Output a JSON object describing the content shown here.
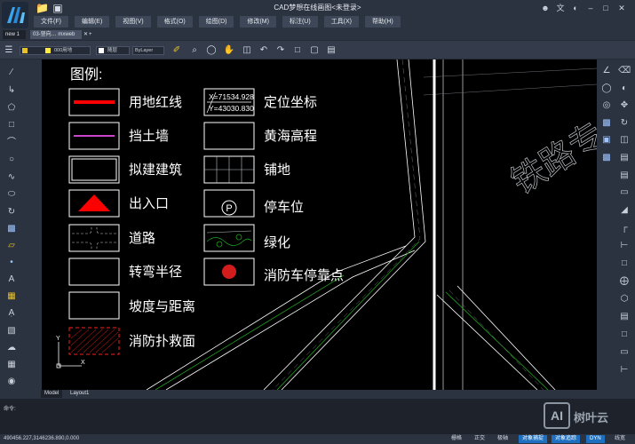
{
  "window": {
    "title": "CAD梦想在线画图<未登录>"
  },
  "menu": [
    "文件(F)",
    "编辑(E)",
    "视图(V)",
    "格式(O)",
    "绘图(D)",
    "修改(M)",
    "标注(U)",
    "工具(X)",
    "帮助(H)"
  ],
  "doc_tabs": [
    {
      "label": "new 1",
      "active": true
    },
    {
      "label": "03-竖向… mxweb",
      "active": false
    }
  ],
  "toolbar": {
    "layer_value": "000用地",
    "color_value": "随层",
    "linetype_value": "ByLayer"
  },
  "legend": {
    "title": "图例:",
    "items": [
      {
        "label": "用地红线"
      },
      {
        "label": "挡土墙"
      },
      {
        "label": "拟建建筑"
      },
      {
        "label": "出入口"
      },
      {
        "label": "道路"
      },
      {
        "label": "转弯半径"
      },
      {
        "label": "坡度与距离"
      },
      {
        "label": "消防扑救面"
      },
      {
        "label": "定位坐标",
        "coord_x": "X=71534.928",
        "coord_y": "Y=43030.830"
      },
      {
        "label": "黄海高程"
      },
      {
        "label": "铺地"
      },
      {
        "label": "停车位",
        "symbol": "P"
      },
      {
        "label": "绿化"
      },
      {
        "label": "消防车停靠点"
      }
    ],
    "road_label": "铁路专",
    "ucs_y": "Y",
    "ucs_x": "X"
  },
  "layout_tabs": [
    "Model",
    "Layout1"
  ],
  "command": {
    "prompt": "命令:"
  },
  "status": {
    "coordinates": "490456.227,3146236.890,0.000",
    "buttons": [
      {
        "label": "栅格",
        "on": false
      },
      {
        "label": "正交",
        "on": false
      },
      {
        "label": "极轴",
        "on": false
      },
      {
        "label": "对象捕捉",
        "on": true
      },
      {
        "label": "对象追踪",
        "on": true
      },
      {
        "label": "DYN",
        "on": true
      },
      {
        "label": "线宽",
        "on": false
      }
    ]
  },
  "watermark": {
    "badge": "AI",
    "text": "树叶云"
  },
  "colors": {
    "background": "#2b3240",
    "canvas": "#000000",
    "accent": "#1e6fbf",
    "red_line": "#ff0000",
    "purple_line": "#cc44cc",
    "green_line": "#1fa31f"
  }
}
